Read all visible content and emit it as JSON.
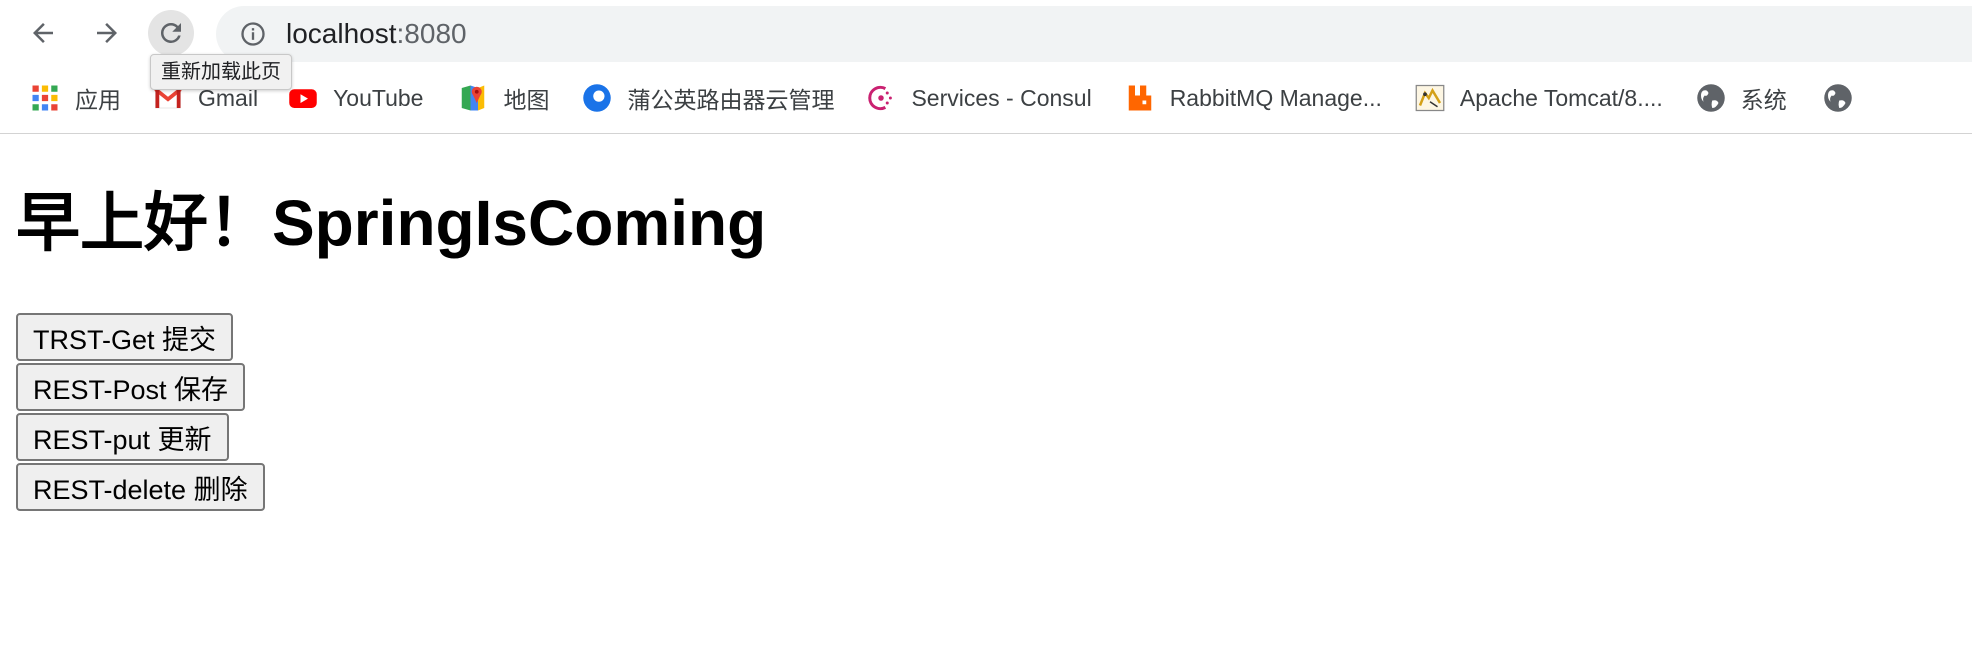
{
  "browser": {
    "url_host": "localhost",
    "url_port": ":8080",
    "reload_tooltip": "重新加载此页"
  },
  "bookmarks": [
    {
      "label": "应用",
      "icon": "apps-grid-icon"
    },
    {
      "label": "Gmail",
      "icon": "gmail-icon"
    },
    {
      "label": "YouTube",
      "icon": "youtube-icon"
    },
    {
      "label": "地图",
      "icon": "google-maps-icon"
    },
    {
      "label": "蒲公英路由器云管理",
      "icon": "dandelion-icon"
    },
    {
      "label": "Services - Consul",
      "icon": "consul-icon"
    },
    {
      "label": "RabbitMQ Manage...",
      "icon": "rabbitmq-icon"
    },
    {
      "label": "Apache Tomcat/8....",
      "icon": "tomcat-icon"
    },
    {
      "label": "系统",
      "icon": "globe-icon"
    },
    {
      "label": "",
      "icon": "globe-icon"
    }
  ],
  "page": {
    "title": "早上好！SpringIsComing",
    "buttons": {
      "get": "TRST-Get 提交",
      "post": "REST-Post 保存",
      "put": "REST-put 更新",
      "delete": "REST-delete 删除"
    }
  },
  "colors": {
    "youtube_red": "#ff0000",
    "rabbitmq_orange": "#ff6600",
    "consul_magenta": "#ca2171",
    "dandelion_blue": "#1a73e8"
  }
}
